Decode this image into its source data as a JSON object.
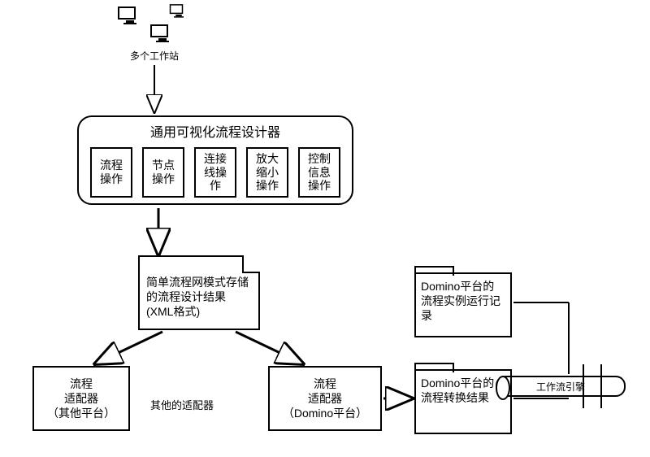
{
  "workstations_label": "多个工作站",
  "designer": {
    "title": "通用可视化流程设计器",
    "boxes": [
      "流程\n操作",
      "节点\n操作",
      "连接\n线操\n作",
      "放大\n缩小\n操作",
      "控制\n信息\n操作"
    ]
  },
  "doc_result": "简单流程网模式存储的流程设计结果(XML格式)",
  "adapter_other": "流程\n适配器\n（其他平台）",
  "adapter_other_ellipsis": "其他的适配器",
  "adapter_domino": "流程\n适配器\n（Domino平台）",
  "folder_instance": "Domino平台的流程实例运行记录",
  "folder_convert": "Domino平台的流程转换结果",
  "engine_label": "工作流引擎"
}
